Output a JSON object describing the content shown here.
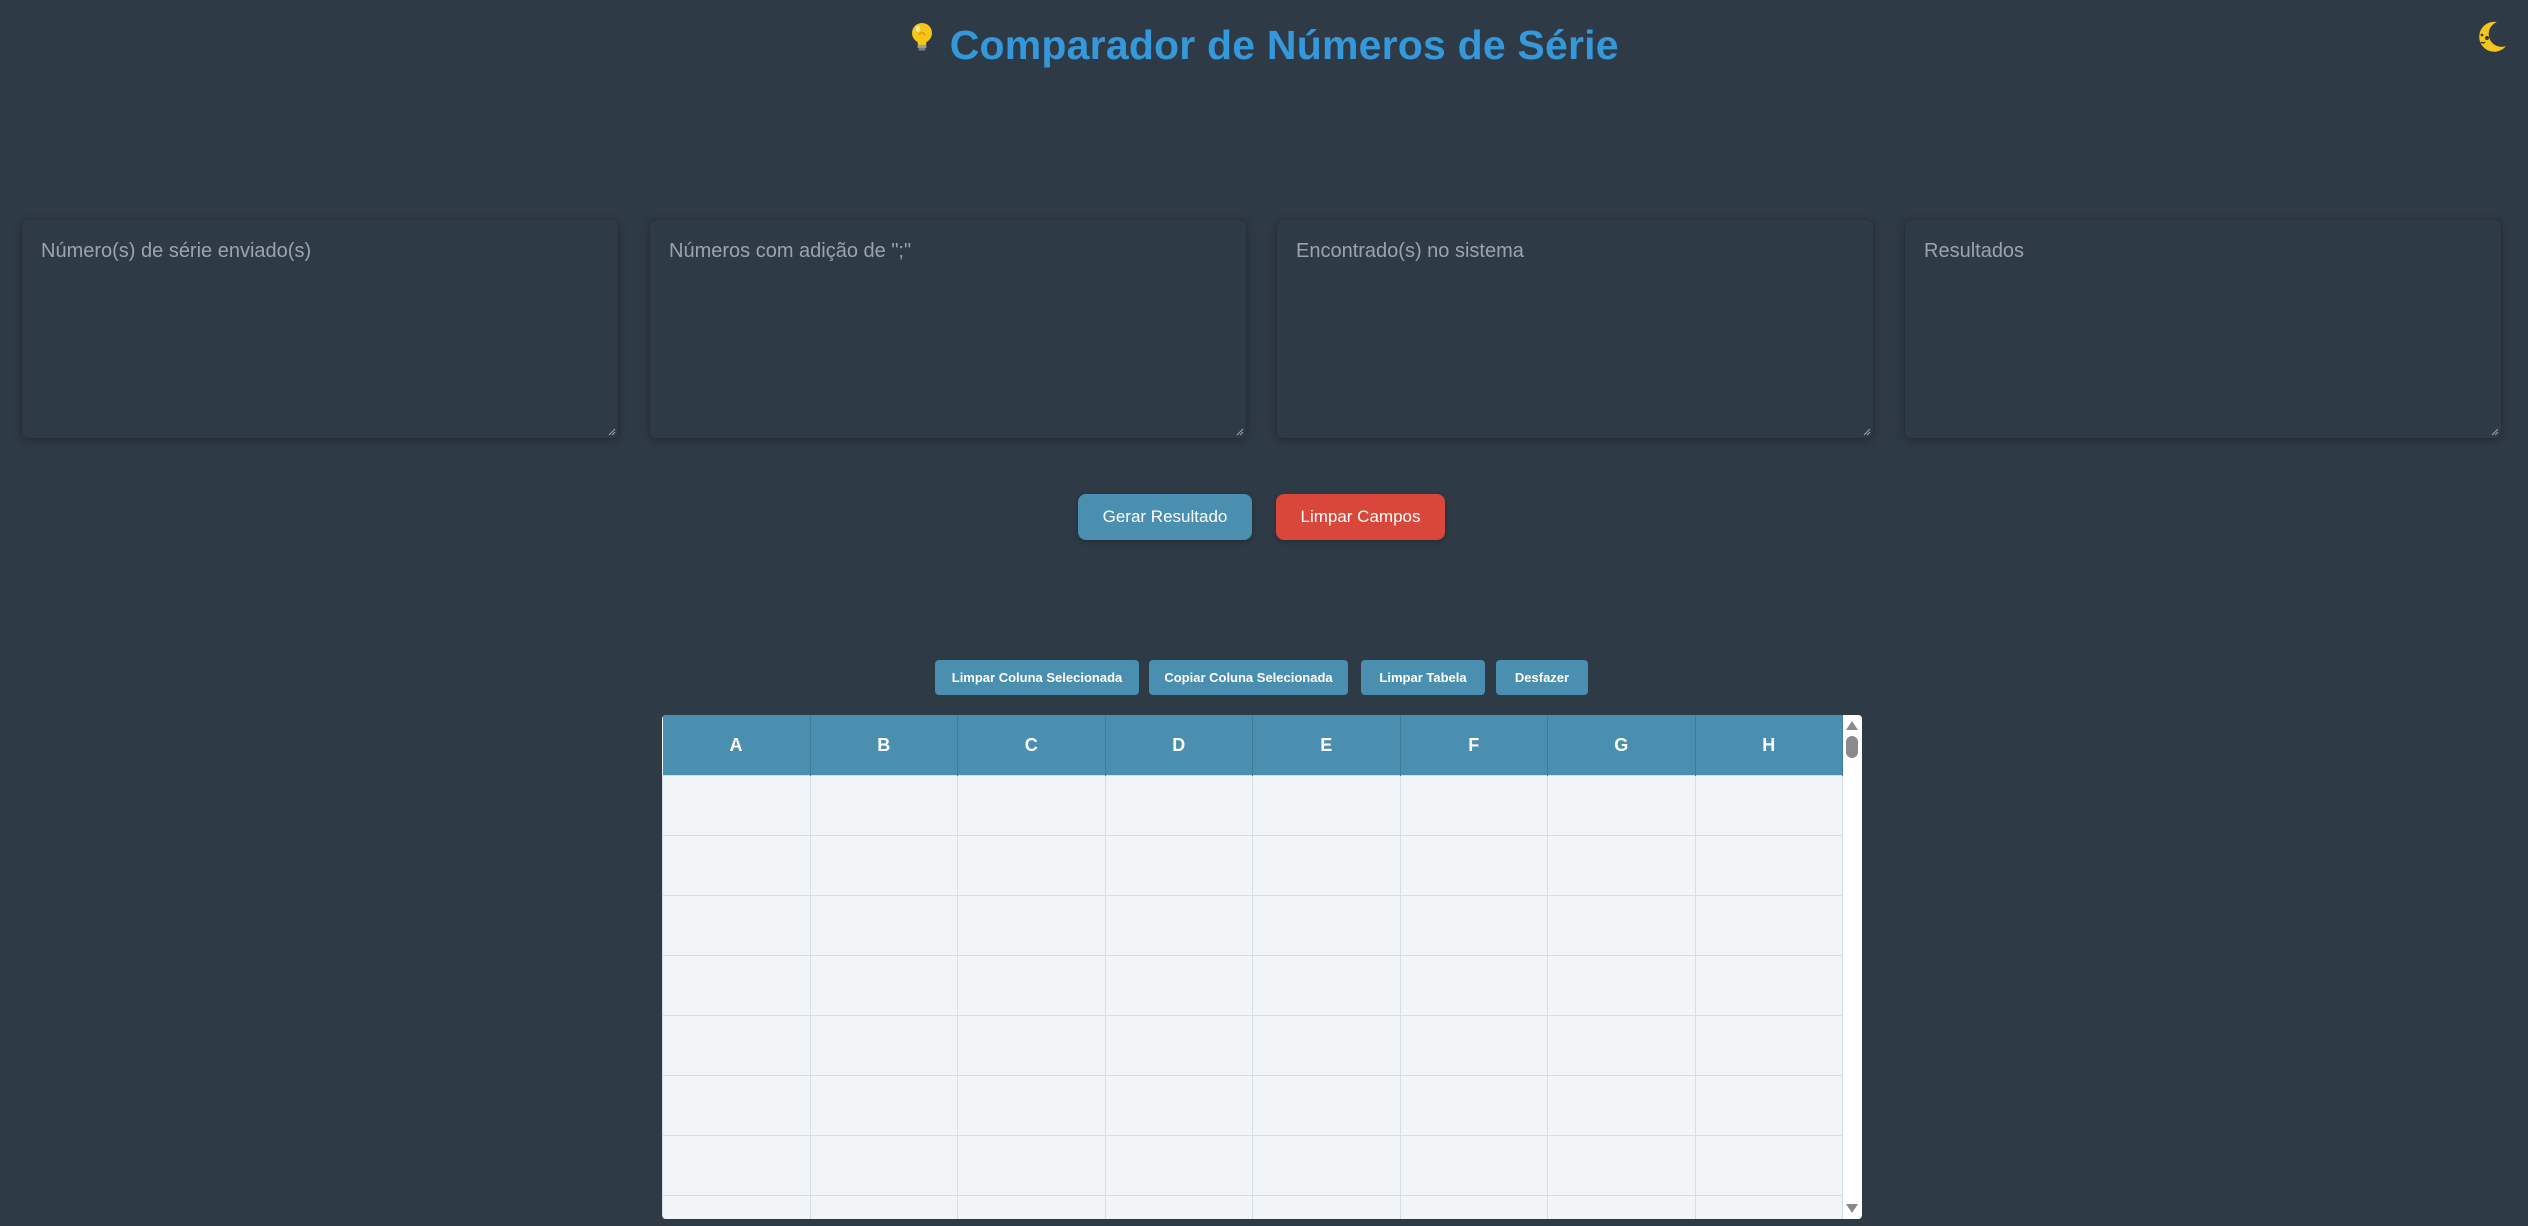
{
  "header": {
    "icon": "lightbulb-icon",
    "title": "Comparador de Números de Série"
  },
  "theme_toggle": {
    "icon": "moon-icon"
  },
  "fields": [
    {
      "placeholder": "Número(s) de série enviado(s)",
      "value": ""
    },
    {
      "placeholder": "Números com adição de \";\"",
      "value": ""
    },
    {
      "placeholder": "Encontrado(s) no sistema",
      "value": ""
    },
    {
      "placeholder": "Resultados",
      "value": ""
    }
  ],
  "actions": {
    "generate_label": "Gerar Resultado",
    "clear_label": "Limpar Campos"
  },
  "table_actions": {
    "clear_column_label": "Limpar Coluna Selecionada",
    "copy_column_label": "Copiar Coluna Selecionada",
    "clear_table_label": "Limpar Tabela",
    "undo_label": "Desfazer"
  },
  "table": {
    "columns": [
      "A",
      "B",
      "C",
      "D",
      "E",
      "F",
      "G",
      "H"
    ]
  },
  "colors": {
    "background": "#2f3a47",
    "title": "#3498db",
    "primary_button": "#4a8fb0",
    "danger_button": "#d9463a",
    "table_header": "#4a8fb0"
  }
}
